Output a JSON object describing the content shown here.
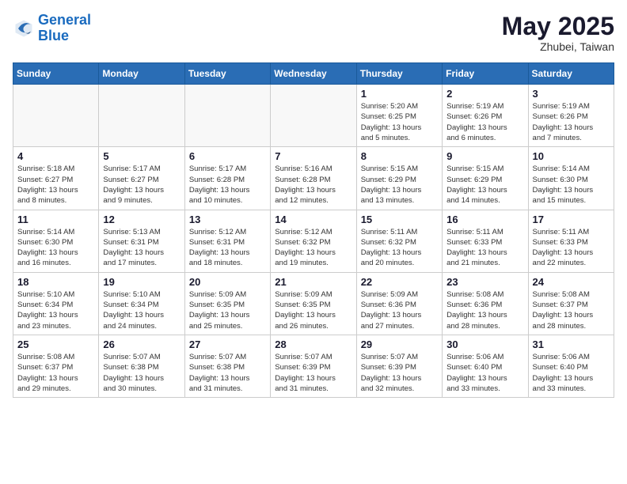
{
  "logo": {
    "line1": "General",
    "line2": "Blue"
  },
  "title": "May 2025",
  "subtitle": "Zhubei, Taiwan",
  "days_header": [
    "Sunday",
    "Monday",
    "Tuesday",
    "Wednesday",
    "Thursday",
    "Friday",
    "Saturday"
  ],
  "weeks": [
    [
      {
        "num": "",
        "info": ""
      },
      {
        "num": "",
        "info": ""
      },
      {
        "num": "",
        "info": ""
      },
      {
        "num": "",
        "info": ""
      },
      {
        "num": "1",
        "info": "Sunrise: 5:20 AM\nSunset: 6:25 PM\nDaylight: 13 hours\nand 5 minutes."
      },
      {
        "num": "2",
        "info": "Sunrise: 5:19 AM\nSunset: 6:26 PM\nDaylight: 13 hours\nand 6 minutes."
      },
      {
        "num": "3",
        "info": "Sunrise: 5:19 AM\nSunset: 6:26 PM\nDaylight: 13 hours\nand 7 minutes."
      }
    ],
    [
      {
        "num": "4",
        "info": "Sunrise: 5:18 AM\nSunset: 6:27 PM\nDaylight: 13 hours\nand 8 minutes."
      },
      {
        "num": "5",
        "info": "Sunrise: 5:17 AM\nSunset: 6:27 PM\nDaylight: 13 hours\nand 9 minutes."
      },
      {
        "num": "6",
        "info": "Sunrise: 5:17 AM\nSunset: 6:28 PM\nDaylight: 13 hours\nand 10 minutes."
      },
      {
        "num": "7",
        "info": "Sunrise: 5:16 AM\nSunset: 6:28 PM\nDaylight: 13 hours\nand 12 minutes."
      },
      {
        "num": "8",
        "info": "Sunrise: 5:15 AM\nSunset: 6:29 PM\nDaylight: 13 hours\nand 13 minutes."
      },
      {
        "num": "9",
        "info": "Sunrise: 5:15 AM\nSunset: 6:29 PM\nDaylight: 13 hours\nand 14 minutes."
      },
      {
        "num": "10",
        "info": "Sunrise: 5:14 AM\nSunset: 6:30 PM\nDaylight: 13 hours\nand 15 minutes."
      }
    ],
    [
      {
        "num": "11",
        "info": "Sunrise: 5:14 AM\nSunset: 6:30 PM\nDaylight: 13 hours\nand 16 minutes."
      },
      {
        "num": "12",
        "info": "Sunrise: 5:13 AM\nSunset: 6:31 PM\nDaylight: 13 hours\nand 17 minutes."
      },
      {
        "num": "13",
        "info": "Sunrise: 5:12 AM\nSunset: 6:31 PM\nDaylight: 13 hours\nand 18 minutes."
      },
      {
        "num": "14",
        "info": "Sunrise: 5:12 AM\nSunset: 6:32 PM\nDaylight: 13 hours\nand 19 minutes."
      },
      {
        "num": "15",
        "info": "Sunrise: 5:11 AM\nSunset: 6:32 PM\nDaylight: 13 hours\nand 20 minutes."
      },
      {
        "num": "16",
        "info": "Sunrise: 5:11 AM\nSunset: 6:33 PM\nDaylight: 13 hours\nand 21 minutes."
      },
      {
        "num": "17",
        "info": "Sunrise: 5:11 AM\nSunset: 6:33 PM\nDaylight: 13 hours\nand 22 minutes."
      }
    ],
    [
      {
        "num": "18",
        "info": "Sunrise: 5:10 AM\nSunset: 6:34 PM\nDaylight: 13 hours\nand 23 minutes."
      },
      {
        "num": "19",
        "info": "Sunrise: 5:10 AM\nSunset: 6:34 PM\nDaylight: 13 hours\nand 24 minutes."
      },
      {
        "num": "20",
        "info": "Sunrise: 5:09 AM\nSunset: 6:35 PM\nDaylight: 13 hours\nand 25 minutes."
      },
      {
        "num": "21",
        "info": "Sunrise: 5:09 AM\nSunset: 6:35 PM\nDaylight: 13 hours\nand 26 minutes."
      },
      {
        "num": "22",
        "info": "Sunrise: 5:09 AM\nSunset: 6:36 PM\nDaylight: 13 hours\nand 27 minutes."
      },
      {
        "num": "23",
        "info": "Sunrise: 5:08 AM\nSunset: 6:36 PM\nDaylight: 13 hours\nand 28 minutes."
      },
      {
        "num": "24",
        "info": "Sunrise: 5:08 AM\nSunset: 6:37 PM\nDaylight: 13 hours\nand 28 minutes."
      }
    ],
    [
      {
        "num": "25",
        "info": "Sunrise: 5:08 AM\nSunset: 6:37 PM\nDaylight: 13 hours\nand 29 minutes."
      },
      {
        "num": "26",
        "info": "Sunrise: 5:07 AM\nSunset: 6:38 PM\nDaylight: 13 hours\nand 30 minutes."
      },
      {
        "num": "27",
        "info": "Sunrise: 5:07 AM\nSunset: 6:38 PM\nDaylight: 13 hours\nand 31 minutes."
      },
      {
        "num": "28",
        "info": "Sunrise: 5:07 AM\nSunset: 6:39 PM\nDaylight: 13 hours\nand 31 minutes."
      },
      {
        "num": "29",
        "info": "Sunrise: 5:07 AM\nSunset: 6:39 PM\nDaylight: 13 hours\nand 32 minutes."
      },
      {
        "num": "30",
        "info": "Sunrise: 5:06 AM\nSunset: 6:40 PM\nDaylight: 13 hours\nand 33 minutes."
      },
      {
        "num": "31",
        "info": "Sunrise: 5:06 AM\nSunset: 6:40 PM\nDaylight: 13 hours\nand 33 minutes."
      }
    ]
  ]
}
